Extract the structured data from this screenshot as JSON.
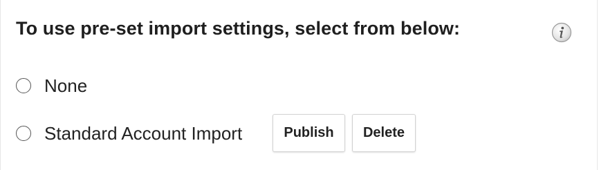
{
  "heading": "To use pre-set import settings, select from below:",
  "info_icon": "info-icon",
  "options": [
    {
      "label": "None",
      "selected": false
    },
    {
      "label": "Standard Account Import",
      "selected": false
    }
  ],
  "buttons": {
    "publish_label": "Publish",
    "delete_label": "Delete"
  }
}
